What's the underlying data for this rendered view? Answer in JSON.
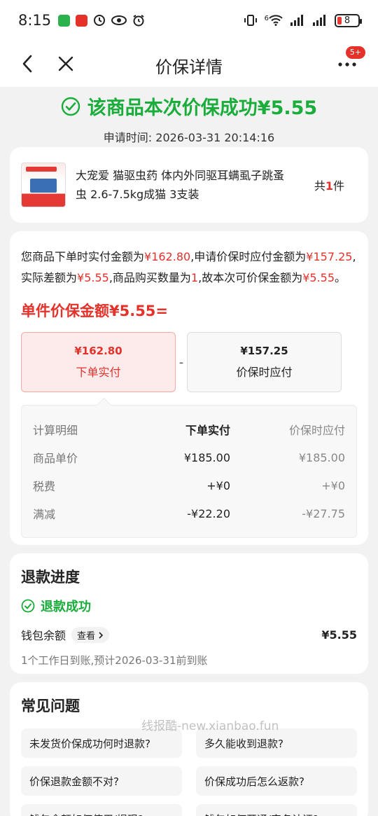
{
  "status_bar": {
    "time": "8:15",
    "network": "6",
    "battery": "8"
  },
  "nav": {
    "title": "价保详情",
    "badge": "5+"
  },
  "header": {
    "success_title": "该商品本次价保成功¥5.55",
    "apply_time_label": "申请时间:",
    "apply_time": "2026-03-31 20:14:16"
  },
  "product": {
    "name": "大宠爱 猫驱虫药 体内外同驱耳螨虱子跳蚤虫 2.6-7.5kg成猫 3支装",
    "count_prefix": "共",
    "count": "1",
    "count_suffix": "件"
  },
  "calc": {
    "explain": [
      {
        "t": "您商品下单时实付金额为",
        "red": false
      },
      {
        "t": "¥162.80",
        "red": true
      },
      {
        "t": ",申请价保时应付金额为",
        "red": false
      },
      {
        "t": "¥157.25",
        "red": true
      },
      {
        "t": ",实际差额为",
        "red": false
      },
      {
        "t": "¥5.55",
        "red": true
      },
      {
        "t": ",商品购买数量为",
        "red": false
      },
      {
        "t": "1",
        "red": true
      },
      {
        "t": ",故本次可价保金额为",
        "red": false
      },
      {
        "t": "¥5.55",
        "red": true
      },
      {
        "t": "。",
        "red": false
      }
    ],
    "unit_line": "单件价保金额¥5.55=",
    "box_paid_amount": "¥162.80",
    "box_paid_label": "下单实付",
    "minus": "-",
    "box_now_amount": "¥157.25",
    "box_now_label": "价保时应付",
    "table": {
      "header": [
        "计算明细",
        "下单实付",
        "价保时应付"
      ],
      "rows": [
        [
          "商品单价",
          "¥185.00",
          "¥185.00"
        ],
        [
          "税费",
          "+¥0",
          "+¥0"
        ],
        [
          "满减",
          "-¥22.20",
          "-¥27.75"
        ]
      ]
    }
  },
  "refund": {
    "title": "退款进度",
    "status": "退款成功",
    "wallet_label": "钱包余额",
    "view_label": "查看",
    "amount": "¥5.55",
    "note": "1个工作日到账,预计2026-03-31前到账"
  },
  "faq": {
    "title": "常见问题",
    "items": [
      "未发货价保成功何时退款?",
      "多久能收到退款?",
      "价保退款金额不对?",
      "价保成功后怎么返款?",
      "钱包余额如何使用/提现?",
      "钱包如何开通/实名认证?"
    ]
  },
  "watermark": "线报酷-new.xianbao.fun",
  "colors": {
    "success_green": "#1aad3b",
    "accent_red": "#e4322b"
  }
}
